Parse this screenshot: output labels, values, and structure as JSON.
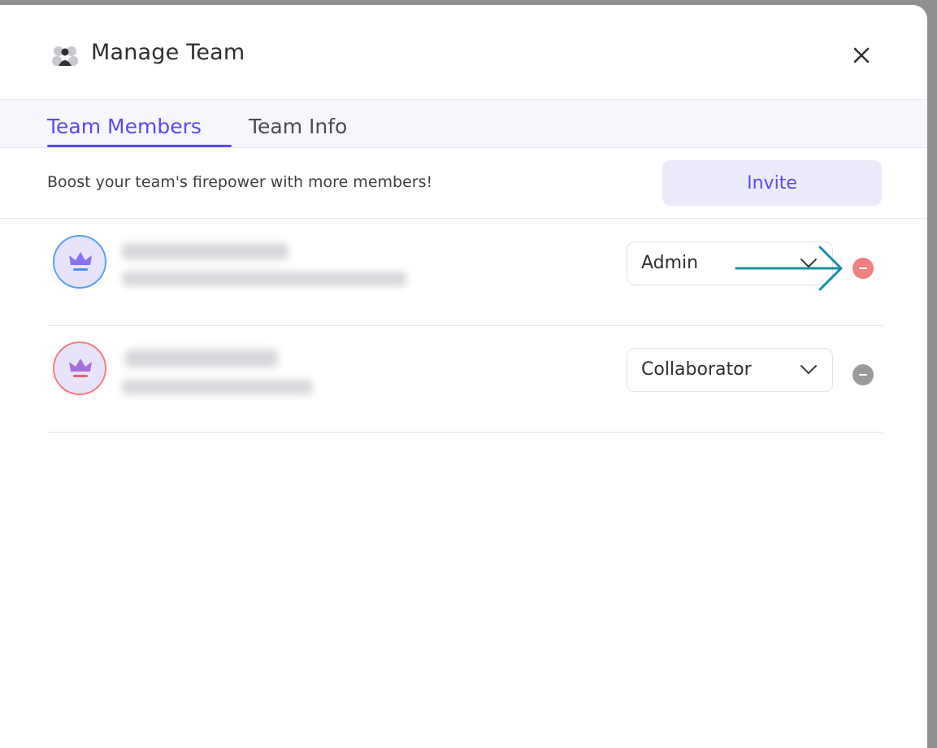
{
  "header": {
    "title": "Manage Team",
    "icon": "team-icon",
    "close_icon": "close-icon"
  },
  "tabs": [
    {
      "label": "Team Members",
      "active": true
    },
    {
      "label": "Team Info",
      "active": false
    }
  ],
  "invite_section": {
    "message": "Boost your team's firepower with more members!",
    "button_label": "Invite"
  },
  "members": [
    {
      "role": "Admin",
      "avatar_icon": "crown-icon",
      "avatar_border": "#5aa1f5",
      "remove_color": "#f07f7f"
    },
    {
      "role": "Collaborator",
      "avatar_icon": "crown-icon",
      "avatar_border": "#f07f7f",
      "remove_color": "#9a9a9a"
    }
  ],
  "annotation": {
    "arrow_color": "#1a8fa6"
  },
  "colors": {
    "accent": "#5a49f0",
    "invite_bg": "#ecebfc",
    "tabs_bg": "#f6f6fd"
  }
}
